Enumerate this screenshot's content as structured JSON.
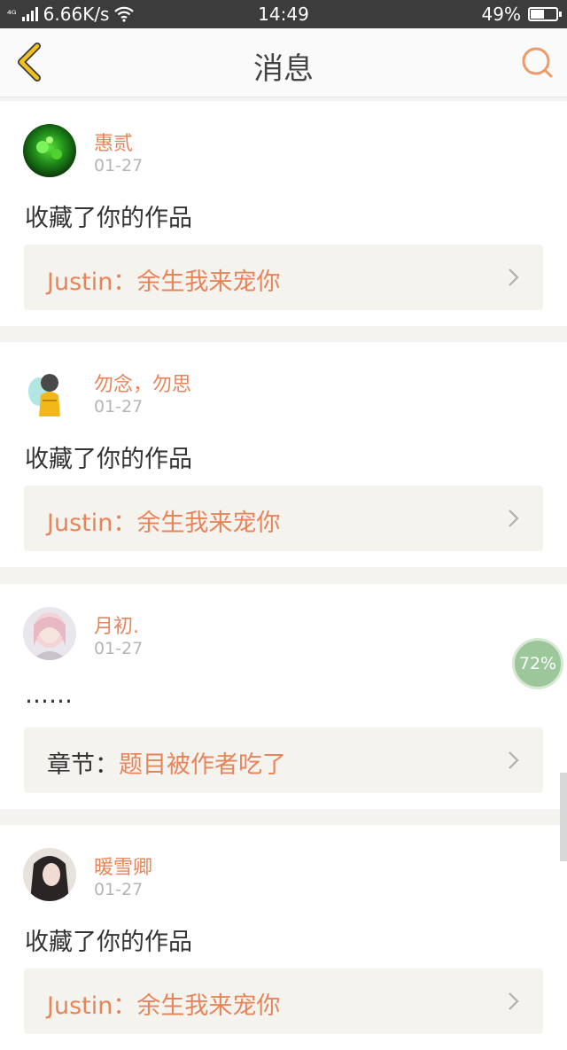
{
  "status_bar": {
    "network": "⁴ᴳ",
    "speed": "6.66K/s",
    "time": "14:49",
    "battery_percent_text": "49%",
    "battery_level": 0.49
  },
  "nav": {
    "title": "消息",
    "back_icon": "chevron-left-icon",
    "search_icon": "search-icon"
  },
  "messages": [
    {
      "user": "惠贰",
      "date": "01-27",
      "action": "收藏了你的作品",
      "work_prefix": "Justin：",
      "work_title": "余生我来宠你"
    },
    {
      "user": "勿念，勿思",
      "date": "01-27",
      "action": "收藏了你的作品",
      "work_prefix": "Justin：",
      "work_title": "余生我来宠你"
    },
    {
      "user": "月初.",
      "date": "01-27",
      "action": "……",
      "work_prefix": "章节：",
      "work_title": "题目被作者吃了"
    },
    {
      "user": "暖雪卿",
      "date": "01-27",
      "action": "收藏了你的作品",
      "work_prefix": "Justin：",
      "work_title": "余生我来宠你"
    }
  ],
  "float_badge": "72%",
  "colors": {
    "accent": "#e8845a",
    "back_icon": "#f2c21a",
    "status_bar": "#3c3c3c"
  }
}
